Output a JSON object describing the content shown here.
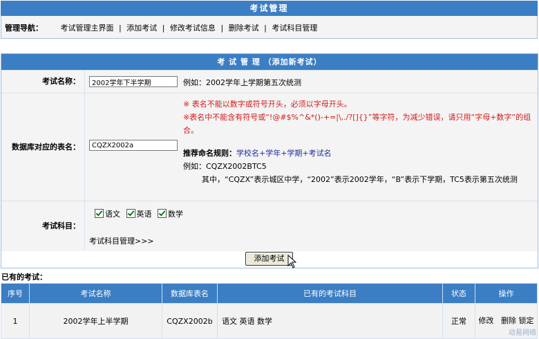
{
  "header": {
    "title": "考试管理"
  },
  "nav": {
    "label": "管理导航：",
    "items": [
      "考试管理主界面",
      "添加考试",
      "修改考试信息",
      "删除考试",
      "考试科目管理"
    ],
    "separator": "|"
  },
  "form": {
    "title": "考 试 管 理 （添加新考试）",
    "exam_name": {
      "label": "考试名称：",
      "value": "2002学年下半学期",
      "example": "例如：2002学年上学期第五次统测"
    },
    "table_name": {
      "label": "数据库对应的表名：",
      "value": "CQZX2002a",
      "note1": "※ 表名不能以数字或符号开头，必须以字母开头。",
      "note2": "※表名中不能含有符号或“!@#$%^&*()-+=|\\,./?[]{}”等字符，为减少错误，请只用“字母+数字”的组合。",
      "rule_label": "推荐命名规则：",
      "rule_value": "学校名+学年+学期+考试名",
      "example": "例如：CQZX2002BTC5",
      "explain": "其中，“CQZX”表示城区中学，“2002”表示2002学年，“B”表示下学期，TC5表示第五次统测"
    },
    "subjects": {
      "label": "考试科目：",
      "options": [
        {
          "label": "语文",
          "checked": true
        },
        {
          "label": "英语",
          "checked": true
        },
        {
          "label": "数学",
          "checked": true
        }
      ],
      "manage_link": "考试科目管理>>>"
    },
    "submit_label": "添加考试"
  },
  "existing": {
    "label": "已有的考试：",
    "columns": [
      "序号",
      "考试名称",
      "数据库表名",
      "已有的考试科目",
      "状态",
      "操作"
    ],
    "rows": [
      {
        "index": "1",
        "name": "2002学年上半学期",
        "table": "CQZX2002b",
        "subjects": "语文 英语 数学",
        "status": "正常",
        "actions": [
          "修改",
          "删除",
          "锁定"
        ]
      }
    ]
  },
  "watermark": "动易网络"
}
